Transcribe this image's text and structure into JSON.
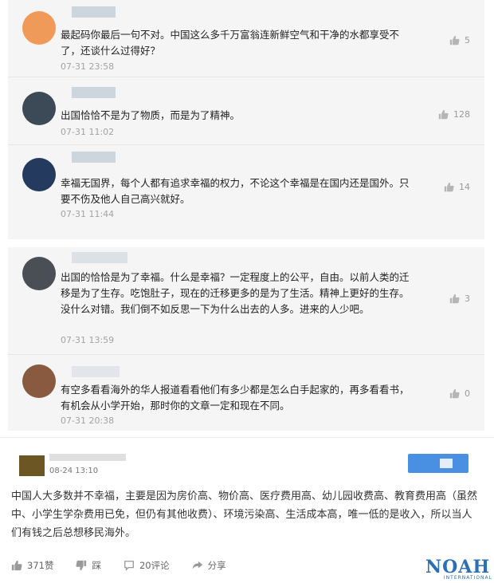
{
  "comments": [
    {
      "text": "最起码你最后一句不对。中国这么多千万富翁连新鲜空气和干净的水都享受不了，还谈什么过得好？",
      "time": "07-31 23:58",
      "likes": "5",
      "avatar_color": "#f09a5a"
    },
    {
      "text": "出国恰恰不是为了物质，而是为了精神。",
      "time": "07-31 11:02",
      "likes": "128",
      "avatar_color": "#3c4a58"
    },
    {
      "text": "幸福无国界，每个人都有追求幸福的权力，不论这个幸福是在国内还是国外。只要不伤及他人自己高兴就好。",
      "time": "07-31 11:44",
      "likes": "14",
      "avatar_color": "#243a5e"
    },
    {
      "text": "出国的恰恰是为了幸福。什么是幸福？一定程度上的公平，自由。以前人类的迁移是为了生存。吃饱肚子，现在的迁移更多的是为了生活。精神上更好的生存。没什么对错。我们倒不如反思一下为什么出去的人多。进来的人少吧。",
      "time": "07-31 13:59",
      "likes": "3",
      "avatar_color": "#4a4f56"
    },
    {
      "text": "有空多看看海外的华人报道看看他们有多少都是怎么白手起家的，再多看看书，有机会从小学开始，那时你的文章一定和现在不同。",
      "time": "07-31 20:38",
      "likes": "0",
      "avatar_color": "#8a5a40"
    }
  ],
  "post": {
    "date": "08-24 13:10",
    "text": "中国人大多数并不幸福，主要是因为房价高、物价高、医疗费用高、幼儿园收费高、教育费用高（虽然中、小学生学杂费用已免，但仍有其他收费）、环境污染高、生活成本高，唯一低的是收入，所以当人们有钱之后总想移民海外。",
    "actions": {
      "like": "371赞",
      "dislike": "踩",
      "comment": "20评论",
      "share": "分享"
    }
  },
  "logo": {
    "word": "NOAH",
    "sub": "INTERNATIONAL"
  },
  "colors": {
    "accent": "#4a90e2",
    "panel": "#f5f5f5",
    "logo": "#2c6fb3"
  }
}
